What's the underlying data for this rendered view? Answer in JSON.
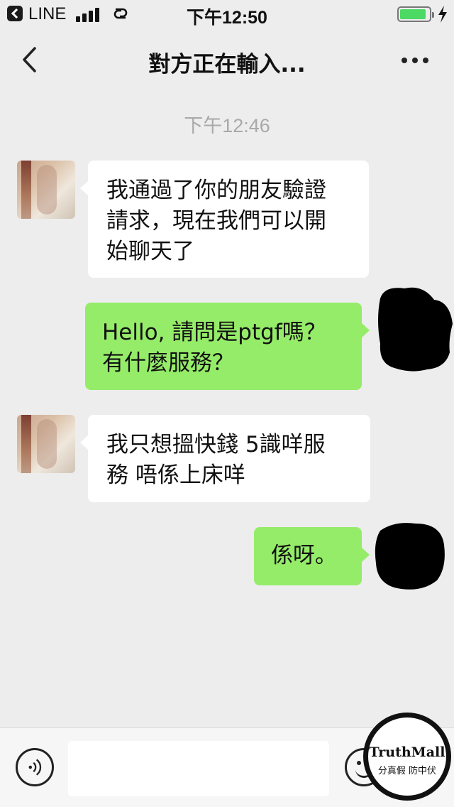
{
  "status_bar": {
    "back_app": "LINE",
    "time": "下午12:50",
    "icons": [
      "back-to-app-icon",
      "signal-bars-icon",
      "link-icon",
      "battery-icon",
      "charging-bolt-icon"
    ]
  },
  "header": {
    "title": "對方正在輸入...",
    "back_icon": "chevron-left-icon",
    "more_icon": "more-dots-icon"
  },
  "timestamp": "下午12:46",
  "messages": [
    {
      "from": "other",
      "text": "我通過了你的朋友驗證\n請求，現在我們可以開\n始聊天了"
    },
    {
      "from": "me",
      "text": "Hello, 請問是ptgf嗎？\n有什麼服務？"
    },
    {
      "from": "other",
      "text": "我只想搵快錢  5識咩服\n務    唔係上床咩"
    },
    {
      "from": "me",
      "text": "係呀。"
    }
  ],
  "input_bar": {
    "value": "",
    "voice_icon": "voice-icon",
    "emoji_icon": "emoji-icon"
  },
  "watermark": {
    "name": "TruthMall",
    "slogan": "分真假 防中伏"
  },
  "colors": {
    "background": "#ededed",
    "outgoing_bubble": "#95ec69",
    "incoming_bubble": "#ffffff",
    "battery": "#4cd964"
  }
}
